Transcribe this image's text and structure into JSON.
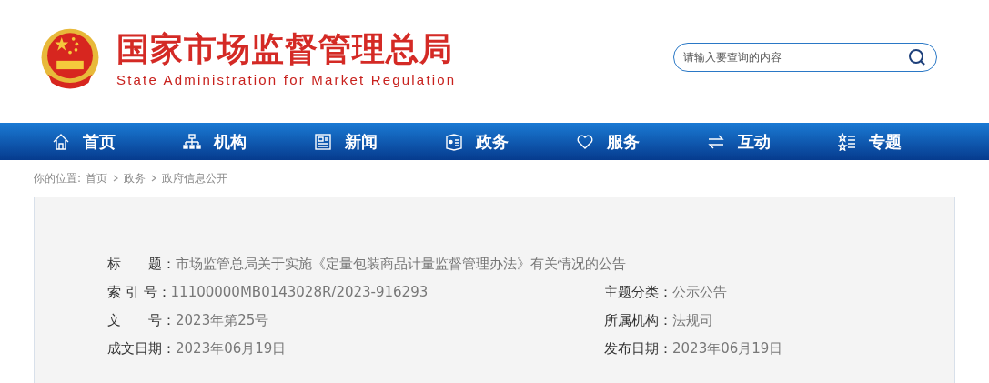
{
  "header": {
    "title": "国家市场监督管理总局",
    "subtitle": "State Administration for Market Regulation"
  },
  "search": {
    "placeholder": "请输入要查询的内容"
  },
  "nav": [
    {
      "label": "首页"
    },
    {
      "label": "机构"
    },
    {
      "label": "新闻"
    },
    {
      "label": "政务"
    },
    {
      "label": "服务"
    },
    {
      "label": "互动"
    },
    {
      "label": "专题"
    }
  ],
  "breadcrumb": {
    "prefix": "你的位置:",
    "items": [
      "首页",
      "政务",
      "政府信息公开"
    ]
  },
  "meta": {
    "title": {
      "label": "标　　题：",
      "value": "市场监管总局关于实施《定量包装商品计量监督管理办法》有关情况的公告"
    },
    "rows": [
      [
        {
          "label": "索 引 号：",
          "value": "11100000MB0143028R/2023-916293"
        },
        {
          "label": "主题分类：",
          "value": "公示公告"
        }
      ],
      [
        {
          "label": "文　　号：",
          "value": "2023年第25号"
        },
        {
          "label": "所属机构：",
          "value": "法规司"
        }
      ],
      [
        {
          "label": "成文日期：",
          "value": "2023年06月19日"
        },
        {
          "label": "发布日期：",
          "value": "2023年06月19日"
        }
      ]
    ]
  }
}
